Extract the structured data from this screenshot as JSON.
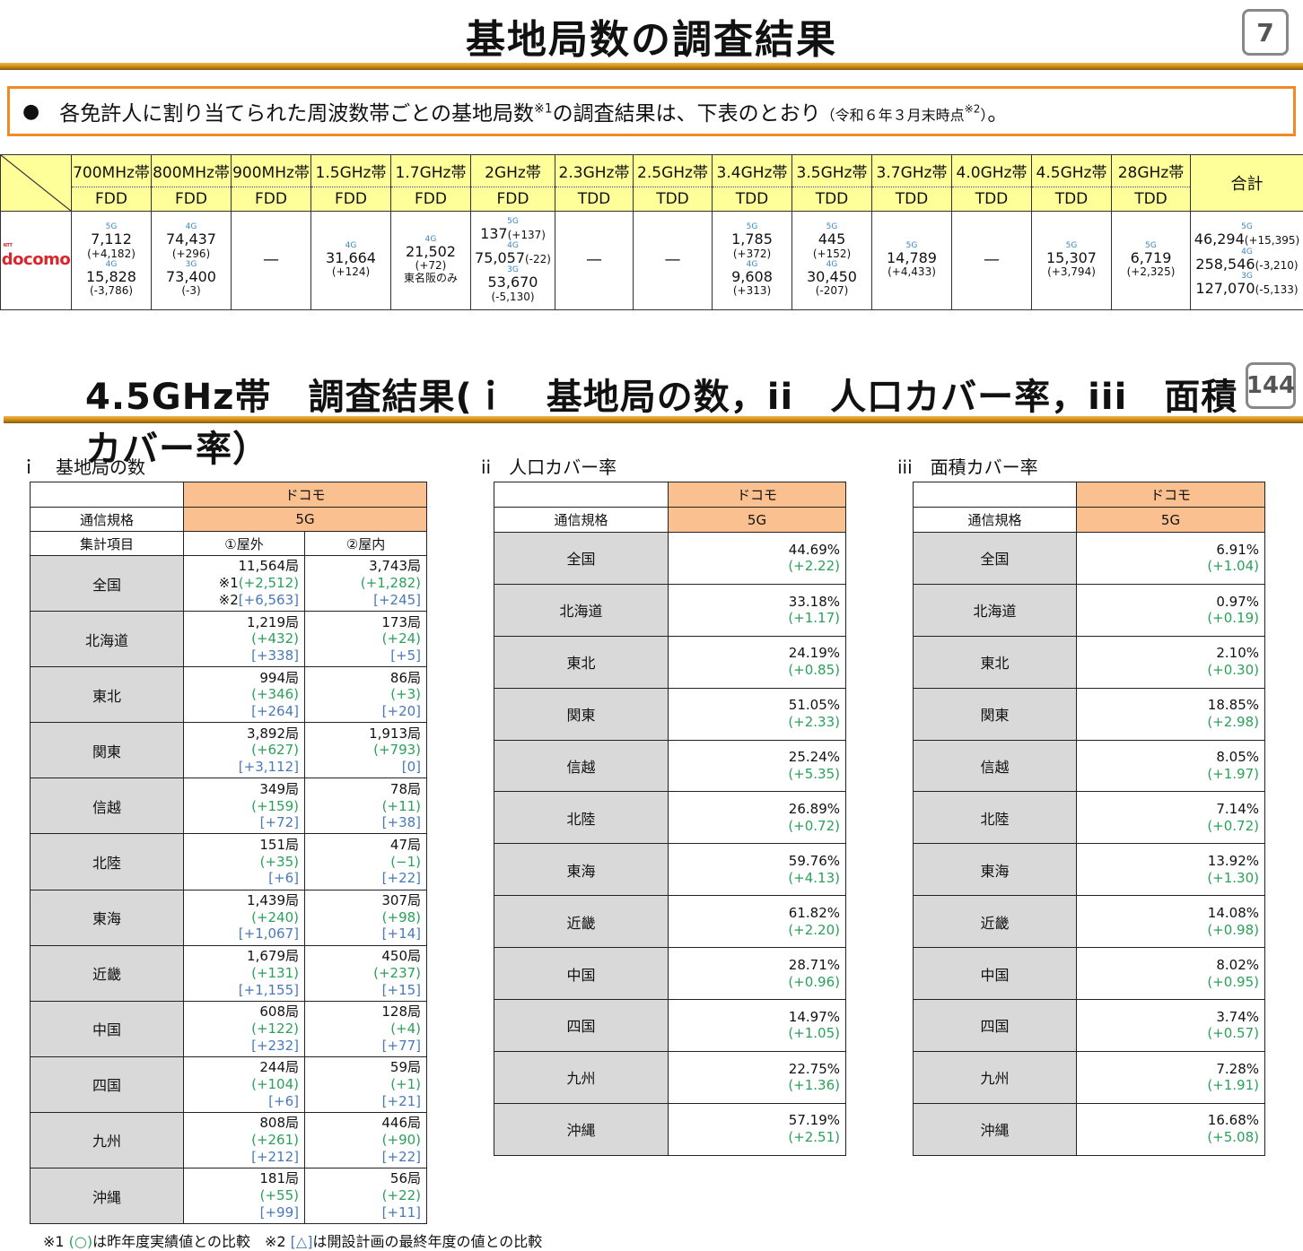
{
  "slide1": {
    "title": "基地局数の調査結果",
    "page_number": "7",
    "note": {
      "main": "各免許人に割り当てられた周波数帯ごとの基地局数",
      "sup1": "※1",
      "mid": "の調査結果は、下表のとおり",
      "paren": "（令和６年３月末時点",
      "sup2": "※2",
      "paren_end": "）",
      "end": "。"
    },
    "bands": [
      {
        "band": "700MHz帯",
        "duplex": "FDD"
      },
      {
        "band": "800MHz帯",
        "duplex": "FDD"
      },
      {
        "band": "900MHz帯",
        "duplex": "FDD"
      },
      {
        "band": "1.5GHz帯",
        "duplex": "FDD"
      },
      {
        "band": "1.7GHz帯",
        "duplex": "FDD"
      },
      {
        "band": "2GHz帯",
        "duplex": "FDD"
      },
      {
        "band": "2.3GHz帯",
        "duplex": "TDD"
      },
      {
        "band": "2.5GHz帯",
        "duplex": "TDD"
      },
      {
        "band": "3.4GHz帯",
        "duplex": "TDD"
      },
      {
        "band": "3.5GHz帯",
        "duplex": "TDD"
      },
      {
        "band": "3.7GHz帯",
        "duplex": "TDD"
      },
      {
        "band": "4.0GHz帯",
        "duplex": "TDD"
      },
      {
        "band": "4.5GHz帯",
        "duplex": "TDD"
      },
      {
        "band": "28GHz帯",
        "duplex": "TDD"
      }
    ],
    "total_label": "合計",
    "operator_logo": {
      "ntt": "NTT",
      "name": "docomo"
    },
    "cells": {
      "b700": [
        {
          "tag": "5G",
          "value": "7,112",
          "diff": "(+4,182)"
        },
        {
          "tag": "4G",
          "value": "15,828",
          "diff": "(-3,786)"
        }
      ],
      "b800": [
        {
          "tag": "4G",
          "value": "74,437",
          "diff": "(+296)"
        },
        {
          "tag": "3G",
          "value": "73,400",
          "diff": "(-3)"
        }
      ],
      "b900": "—",
      "b15": [
        {
          "tag": "4G",
          "value": "31,664",
          "diff": "(+124)"
        }
      ],
      "b17": {
        "tag": "4G",
        "value": "21,502",
        "diff": "(+72)",
        "note": "東名阪のみ"
      },
      "b2": [
        {
          "tag": "5G",
          "value": "137",
          "diff": "(+137)"
        },
        {
          "tag": "4G",
          "value": "75,057",
          "diff": "(-22)"
        },
        {
          "tag": "3G",
          "value": "53,670",
          "diff": "(-5,130)"
        }
      ],
      "b23": "—",
      "b25": "—",
      "b34": [
        {
          "tag": "5G",
          "value": "1,785",
          "diff": "(+372)"
        },
        {
          "tag": "4G",
          "value": "9,608",
          "diff": "(+313)"
        }
      ],
      "b35": [
        {
          "tag": "5G",
          "value": "445",
          "diff": "(+152)"
        },
        {
          "tag": "4G",
          "value": "30,450",
          "diff": "(-207)"
        }
      ],
      "b37": [
        {
          "tag": "5G",
          "value": "14,789",
          "diff": "(+4,433)"
        }
      ],
      "b40": "—",
      "b45": [
        {
          "tag": "5G",
          "value": "15,307",
          "diff": "(+3,794)"
        }
      ],
      "b28": [
        {
          "tag": "5G",
          "value": "6,719",
          "diff": "(+2,325)"
        }
      ],
      "total": [
        {
          "tag": "5G",
          "value": "46,294",
          "diff": "(+15,395)"
        },
        {
          "tag": "4G",
          "value": "258,546",
          "diff": "(-3,210)"
        },
        {
          "tag": "3G",
          "value": "127,070",
          "diff": "(-5,133)"
        }
      ]
    }
  },
  "slide2": {
    "title": "4.5GHz帯　調査結果(ｉ　基地局の数，ii　人口カバー率，iii　面積カバー率）",
    "page_number": "144",
    "section_i": "ｉ　基地局の数",
    "section_ii": "ii　人口カバー率",
    "section_iii": "iii　面積カバー率",
    "operator": "ドコモ",
    "standard_label": "通信規格",
    "standard": "5G",
    "agg_label": "集計項目",
    "outdoor_label": "①屋外",
    "indoor_label": "②屋内",
    "mark1": "※1",
    "mark2": "※2",
    "stations": [
      {
        "region": "全国",
        "out": "11,564局",
        "out_d1": "(+2,512)",
        "out_d2": "[+6,563]",
        "in": "3,743局",
        "in_d1": "(+1,282)",
        "in_d2": "[+245]"
      },
      {
        "region": "北海道",
        "out": "1,219局",
        "out_d1": "(+432)",
        "out_d2": "[+338]",
        "in": "173局",
        "in_d1": "(+24)",
        "in_d2": "[+5]"
      },
      {
        "region": "東北",
        "out": "994局",
        "out_d1": "(+346)",
        "out_d2": "[+264]",
        "in": "86局",
        "in_d1": "(+3)",
        "in_d2": "[+20]"
      },
      {
        "region": "関東",
        "out": "3,892局",
        "out_d1": "(+627)",
        "out_d2": "[+3,112]",
        "in": "1,913局",
        "in_d1": "(+793)",
        "in_d2": "[0]"
      },
      {
        "region": "信越",
        "out": "349局",
        "out_d1": "(+159)",
        "out_d2": "[+72]",
        "in": "78局",
        "in_d1": "(+11)",
        "in_d2": "[+38]"
      },
      {
        "region": "北陸",
        "out": "151局",
        "out_d1": "(+35)",
        "out_d2": "[+6]",
        "in": "47局",
        "in_d1": "(−1)",
        "in_d2": "[+22]"
      },
      {
        "region": "東海",
        "out": "1,439局",
        "out_d1": "(+240)",
        "out_d2": "[+1,067]",
        "in": "307局",
        "in_d1": "(+98)",
        "in_d2": "[+14]"
      },
      {
        "region": "近畿",
        "out": "1,679局",
        "out_d1": "(+131)",
        "out_d2": "[+1,155]",
        "in": "450局",
        "in_d1": "(+237)",
        "in_d2": "[+15]"
      },
      {
        "region": "中国",
        "out": "608局",
        "out_d1": "(+122)",
        "out_d2": "[+232]",
        "in": "128局",
        "in_d1": "(+4)",
        "in_d2": "[+77]"
      },
      {
        "region": "四国",
        "out": "244局",
        "out_d1": "(+104)",
        "out_d2": "[+6]",
        "in": "59局",
        "in_d1": "(+1)",
        "in_d2": "[+21]"
      },
      {
        "region": "九州",
        "out": "808局",
        "out_d1": "(+261)",
        "out_d2": "[+212]",
        "in": "446局",
        "in_d1": "(+90)",
        "in_d2": "[+22]"
      },
      {
        "region": "沖縄",
        "out": "181局",
        "out_d1": "(+55)",
        "out_d2": "[+99]",
        "in": "56局",
        "in_d1": "(+22)",
        "in_d2": "[+11]"
      }
    ],
    "population": [
      {
        "region": "全国",
        "value": "44.69%",
        "diff": "(+2.22)"
      },
      {
        "region": "北海道",
        "value": "33.18%",
        "diff": "(+1.17)"
      },
      {
        "region": "東北",
        "value": "24.19%",
        "diff": "(+0.85)"
      },
      {
        "region": "関東",
        "value": "51.05%",
        "diff": "(+2.33)"
      },
      {
        "region": "信越",
        "value": "25.24%",
        "diff": "(+5.35)"
      },
      {
        "region": "北陸",
        "value": "26.89%",
        "diff": "(+0.72)"
      },
      {
        "region": "東海",
        "value": "59.76%",
        "diff": "(+4.13)"
      },
      {
        "region": "近畿",
        "value": "61.82%",
        "diff": "(+2.20)"
      },
      {
        "region": "中国",
        "value": "28.71%",
        "diff": "(+0.96)"
      },
      {
        "region": "四国",
        "value": "14.97%",
        "diff": "(+1.05)"
      },
      {
        "region": "九州",
        "value": "22.75%",
        "diff": "(+1.36)"
      },
      {
        "region": "沖縄",
        "value": "57.19%",
        "diff": "(+2.51)"
      }
    ],
    "area": [
      {
        "region": "全国",
        "value": "6.91%",
        "diff": "(+1.04)"
      },
      {
        "region": "北海道",
        "value": "0.97%",
        "diff": "(+0.19)"
      },
      {
        "region": "東北",
        "value": "2.10%",
        "diff": "(+0.30)"
      },
      {
        "region": "関東",
        "value": "18.85%",
        "diff": "(+2.98)"
      },
      {
        "region": "信越",
        "value": "8.05%",
        "diff": "(+1.97)"
      },
      {
        "region": "北陸",
        "value": "7.14%",
        "diff": "(+0.72)"
      },
      {
        "region": "東海",
        "value": "13.92%",
        "diff": "(+1.30)"
      },
      {
        "region": "近畿",
        "value": "14.08%",
        "diff": "(+0.98)"
      },
      {
        "region": "中国",
        "value": "8.02%",
        "diff": "(+0.95)"
      },
      {
        "region": "四国",
        "value": "3.74%",
        "diff": "(+0.57)"
      },
      {
        "region": "九州",
        "value": "7.28%",
        "diff": "(+1.91)"
      },
      {
        "region": "沖縄",
        "value": "16.68%",
        "diff": "(+5.08)"
      }
    ],
    "footnote": {
      "p1": "※1 ",
      "p1_sym": "(○)",
      "p1_text": "は昨年度実績値との比較　",
      "p2": "※2 ",
      "p2_sym": "[△]",
      "p2_text": "は開設計画の最終年度の値との比較"
    }
  }
}
